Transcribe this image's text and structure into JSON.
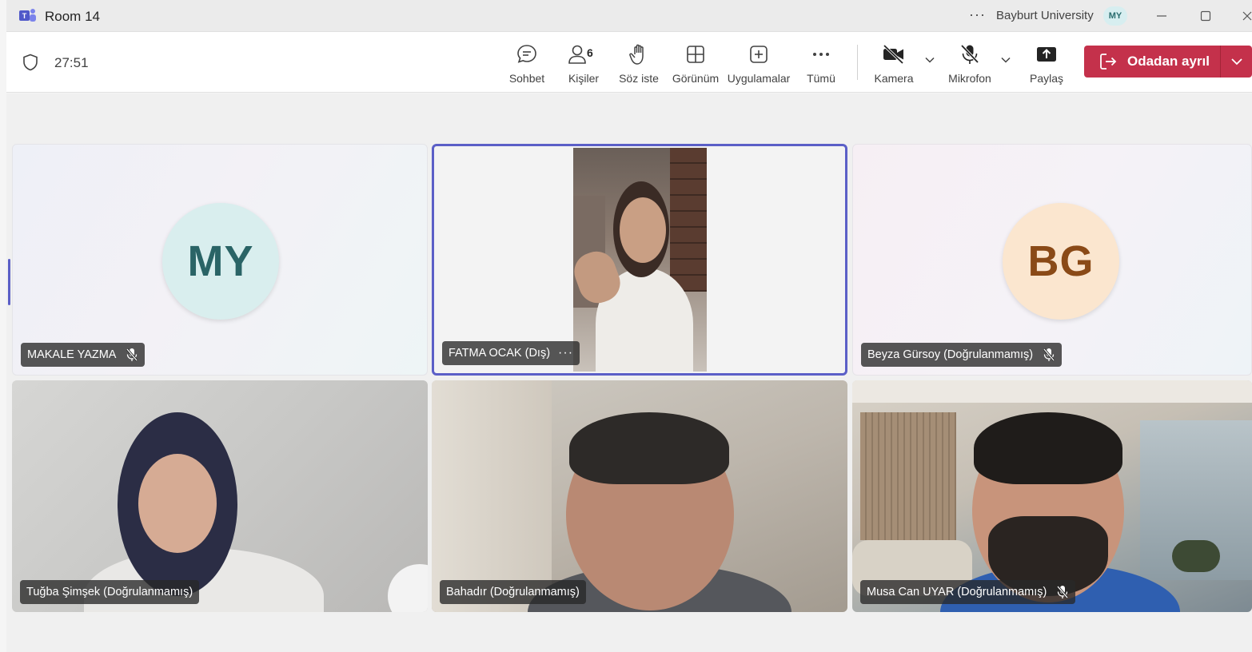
{
  "window": {
    "title": "Room 14",
    "organization": "Bayburt University",
    "user_initials": "MY",
    "more_label": "···"
  },
  "toolbar": {
    "timer": "27:51",
    "chat": "Sohbet",
    "people": "Kişiler",
    "people_count": "6",
    "raise_hand": "Söz iste",
    "view": "Görünüm",
    "apps": "Uygulamalar",
    "more": "Tümü",
    "camera": "Kamera",
    "mic": "Mikrofon",
    "share": "Paylaş",
    "leave": "Odadan ayrıl"
  },
  "colors": {
    "accent": "#5b5fc7",
    "leave": "#c4314b"
  },
  "participants": [
    {
      "name": "MAKALE YAZMA",
      "initials": "MY",
      "video": false,
      "muted": true
    },
    {
      "name": "FATMA OCAK (Dış)",
      "video": true,
      "muted": false,
      "speaking": true
    },
    {
      "name": "Beyza Gürsoy (Doğrulanmamış)",
      "initials": "BG",
      "video": false,
      "muted": true
    },
    {
      "name": "Tuğba Şimşek (Doğrulanmamış)",
      "video": true,
      "muted": false
    },
    {
      "name": "Bahadır (Doğrulanmamış)",
      "video": true,
      "muted": false
    },
    {
      "name": "Musa Can UYAR (Doğrulanmamış)",
      "video": true,
      "muted": true
    }
  ]
}
